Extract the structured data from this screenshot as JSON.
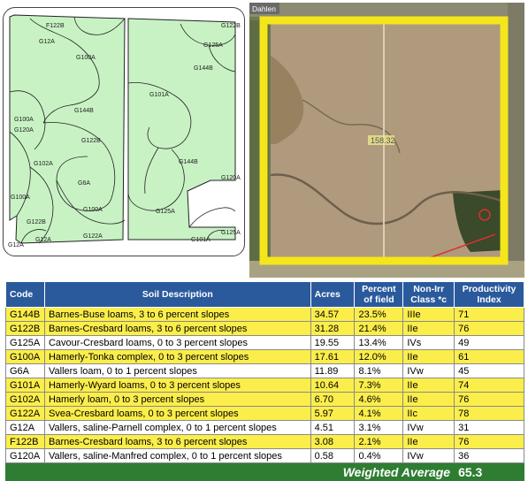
{
  "soil_map": {
    "units": [
      {
        "label": "F122B"
      },
      {
        "label": "G12A"
      },
      {
        "label": "G100A"
      },
      {
        "label": "G125A"
      },
      {
        "label": "G122B"
      },
      {
        "label": "G144B"
      },
      {
        "label": "G101A"
      },
      {
        "label": "G100A"
      },
      {
        "label": "G120A"
      },
      {
        "label": "G144B"
      },
      {
        "label": "G122B"
      },
      {
        "label": "G102A"
      },
      {
        "label": "G144B"
      },
      {
        "label": "G6A"
      },
      {
        "label": "G100A"
      },
      {
        "label": "G100A"
      },
      {
        "label": "G125A"
      },
      {
        "label": "G120A"
      },
      {
        "label": "G122B"
      },
      {
        "label": "G122A"
      },
      {
        "label": "G12A"
      },
      {
        "label": "G12A"
      },
      {
        "label": "G125A"
      },
      {
        "label": "G101A"
      }
    ]
  },
  "aerial": {
    "road_label": "Dahlen",
    "field_label": "158.32",
    "colors": {
      "boundary": "#f5e61b",
      "field": "#b09a7e",
      "trees": "#3a4a2a"
    }
  },
  "table": {
    "headers": {
      "code": "Code",
      "description": "Soil Description",
      "acres": "Acres",
      "percent": "Percent of field",
      "class": "Non-Irr Class *c",
      "productivity": "Productivity Index"
    },
    "rows": [
      {
        "code": "G144B",
        "description": "Barnes-Buse loams, 3 to 6 percent slopes",
        "acres": "34.57",
        "percent": "23.5%",
        "class": "IIIe",
        "pi": "71",
        "highlight": true
      },
      {
        "code": "G122B",
        "description": "Barnes-Cresbard loams, 3 to 6 percent slopes",
        "acres": "31.28",
        "percent": "21.4%",
        "class": "IIe",
        "pi": "76",
        "highlight": true
      },
      {
        "code": "G125A",
        "description": "Cavour-Cresbard loams, 0 to 3 percent slopes",
        "acres": "19.55",
        "percent": "13.4%",
        "class": "IVs",
        "pi": "49",
        "highlight": false
      },
      {
        "code": "G100A",
        "description": "Hamerly-Tonka complex, 0 to 3 percent slopes",
        "acres": "17.61",
        "percent": "12.0%",
        "class": "IIe",
        "pi": "61",
        "highlight": true
      },
      {
        "code": "G6A",
        "description": "Vallers loam, 0 to 1 percent slopes",
        "acres": "11.89",
        "percent": "8.1%",
        "class": "IVw",
        "pi": "45",
        "highlight": false
      },
      {
        "code": "G101A",
        "description": "Hamerly-Wyard loams, 0 to 3 percent slopes",
        "acres": "10.64",
        "percent": "7.3%",
        "class": "IIe",
        "pi": "74",
        "highlight": true
      },
      {
        "code": "G102A",
        "description": "Hamerly loam, 0 to 3 percent slopes",
        "acres": "6.70",
        "percent": "4.6%",
        "class": "IIe",
        "pi": "76",
        "highlight": true
      },
      {
        "code": "G122A",
        "description": "Svea-Cresbard loams, 0 to 3 percent slopes",
        "acres": "5.97",
        "percent": "4.1%",
        "class": "IIc",
        "pi": "78",
        "highlight": true
      },
      {
        "code": "G12A",
        "description": "Vallers, saline-Parnell complex, 0 to 1 percent slopes",
        "acres": "4.51",
        "percent": "3.1%",
        "class": "IVw",
        "pi": "31",
        "highlight": false
      },
      {
        "code": "F122B",
        "description": "Barnes-Cresbard loams, 3 to 6 percent slopes",
        "acres": "3.08",
        "percent": "2.1%",
        "class": "IIe",
        "pi": "76",
        "highlight": true
      },
      {
        "code": "G120A",
        "description": "Vallers, saline-Manfred complex, 0 to 1 percent slopes",
        "acres": "0.58",
        "percent": "0.4%",
        "class": "IVw",
        "pi": "36",
        "highlight": false
      }
    ],
    "weighted_average_label": "Weighted Average",
    "weighted_average_value": "65.3",
    "colors": {
      "header": "#2a5a9c",
      "highlight": "#fbee4b",
      "footer": "#2e7d32",
      "map_fill": "#c8f2c4"
    }
  }
}
